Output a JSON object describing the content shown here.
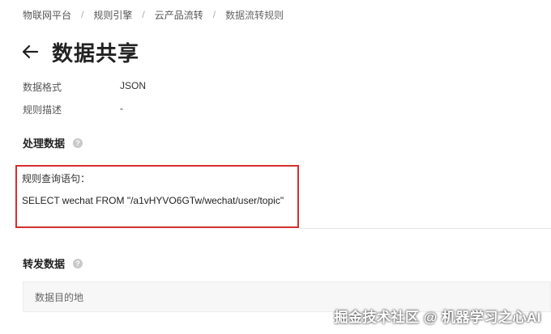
{
  "breadcrumb": [
    "物联网平台",
    "规则引擎",
    "云产品流转",
    "数据流转规则"
  ],
  "breadcrumb_separator": "/",
  "page_title": "数据共享",
  "info": [
    {
      "label": "数据格式",
      "value": "JSON"
    },
    {
      "label": "规则描述",
      "value": "-"
    }
  ],
  "sections": {
    "process": {
      "title": "处理数据"
    },
    "forward": {
      "title": "转发数据"
    }
  },
  "query": {
    "label": "规则查询语句：",
    "statement": "SELECT wechat FROM \"/a1vHYVO6GTw/wechat/user/topic\""
  },
  "destination": {
    "label": "数据目的地"
  },
  "watermark": "掘金技术社区 @ 机器学习之心AI",
  "colors": {
    "highlight_border": "#d32f2f",
    "help_icon": "#c9c9c9"
  },
  "icons": {
    "back": "arrow-left-icon",
    "help": "question-circle-icon"
  }
}
